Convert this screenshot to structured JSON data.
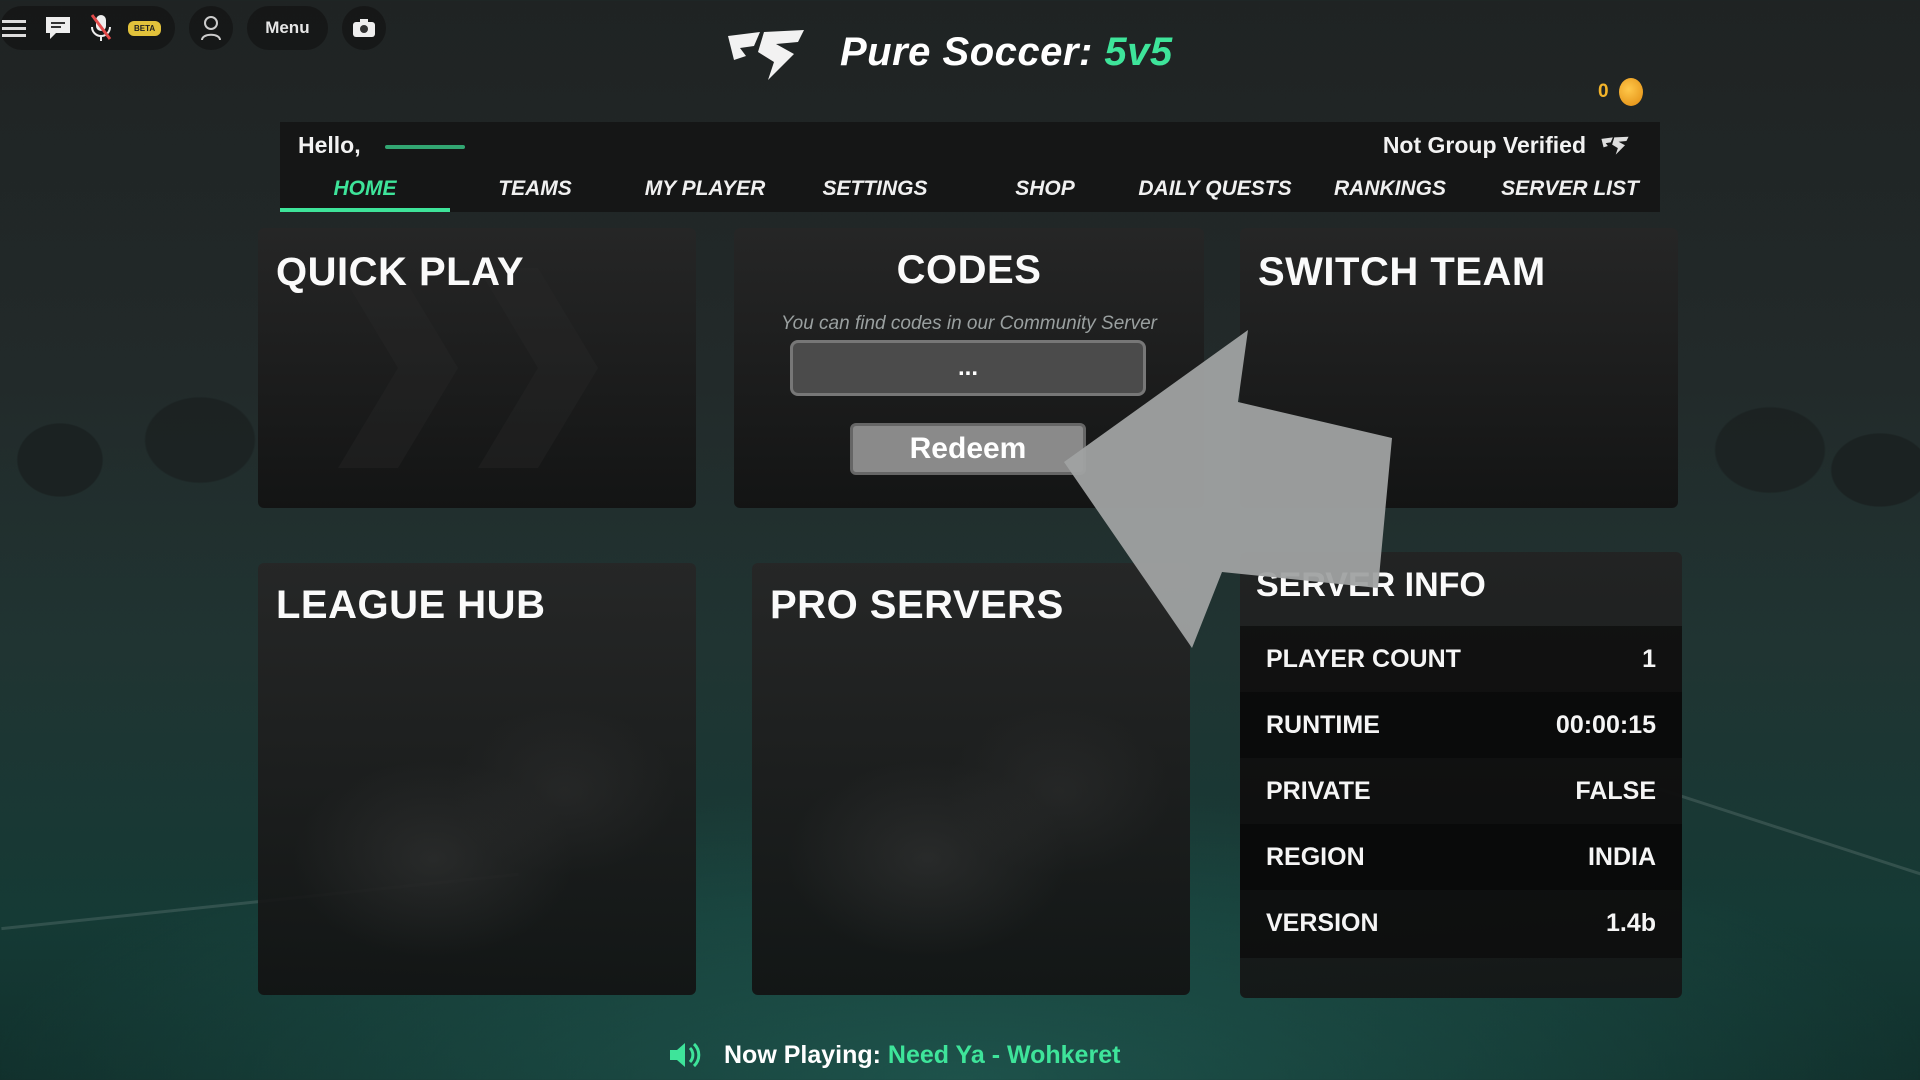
{
  "roblox_bar": {
    "menu_label": "Menu",
    "beta_label": "BETA",
    "icons": [
      "hamburger-icon",
      "chat-icon",
      "mic-off-icon",
      "avatar-icon",
      "camera-icon"
    ]
  },
  "header": {
    "title_main": "Pure Soccer:",
    "title_accent": "5v5",
    "coins": "0"
  },
  "nav": {
    "greeting": "Hello,",
    "verify_status": "Not Group Verified",
    "tabs": [
      "HOME",
      "TEAMS",
      "MY PLAYER",
      "SETTINGS",
      "SHOP",
      "DAILY QUESTS",
      "RANKINGS",
      "SERVER LIST"
    ],
    "active_tab": "HOME"
  },
  "panels": {
    "quick_play": "QUICK PLAY",
    "codes": {
      "title": "CODES",
      "subtitle": "You can find codes in our Community Server",
      "input_placeholder": "...",
      "redeem_label": "Redeem"
    },
    "switch_team": "SWITCH TEAM",
    "league_hub": "LEAGUE HUB",
    "pro_servers": "PRO SERVERS"
  },
  "server_info": {
    "title": "SERVER INFO",
    "rows": [
      {
        "label": "PLAYER COUNT",
        "value": "1"
      },
      {
        "label": "RUNTIME",
        "value": "00:00:15"
      },
      {
        "label": "PRIVATE",
        "value": "FALSE"
      },
      {
        "label": "REGION",
        "value": "INDIA"
      },
      {
        "label": "VERSION",
        "value": "1.4b"
      }
    ]
  },
  "now_playing": {
    "label": "Now Playing:",
    "song": "Need Ya - Wohkeret"
  },
  "colors": {
    "accent": "#3ee49a",
    "coin": "#f3b42a",
    "arrow": "#a0a2a2"
  }
}
